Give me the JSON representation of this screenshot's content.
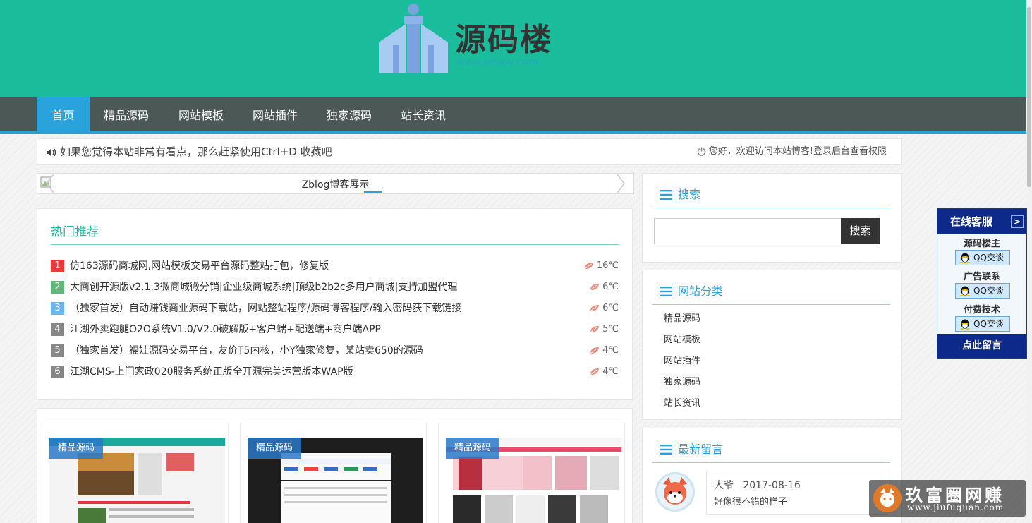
{
  "site": {
    "logo_text": "源码楼",
    "logo_url_text": "www.ymlou.com"
  },
  "nav": {
    "items": [
      {
        "label": "首页",
        "active": true
      },
      {
        "label": "精品源码",
        "active": false
      },
      {
        "label": "网站模板",
        "active": false
      },
      {
        "label": "网站插件",
        "active": false
      },
      {
        "label": "独家源码",
        "active": false
      },
      {
        "label": "站长资讯",
        "active": false
      }
    ]
  },
  "notice": {
    "left": "如果您觉得本站非常有看点，那么赶紧使用Ctrl+D 收藏吧",
    "right": "您好，欢迎访问本站博客!登录后台查看权限"
  },
  "slider": {
    "caption": "Zblog博客展示"
  },
  "hot": {
    "title": "热门推荐",
    "items": [
      {
        "num": "1",
        "text": "仿163源码商城网,网站模板交易平台源码整站打包，修复版",
        "temp": "16℃",
        "color": "#e83c3c"
      },
      {
        "num": "2",
        "text": "大商创开源版v2.1.3微商城微分销|企业级商城系统|顶级b2b2c多用户商城|支持加盟代理",
        "temp": "6℃",
        "color": "#5fb878"
      },
      {
        "num": "3",
        "text": "（独家首发）自动赚钱商业源码下载站，网站整站程序/源码博客程序/输入密码获下载链接",
        "temp": "6℃",
        "color": "#6bb6ea"
      },
      {
        "num": "4",
        "text": "江湖外卖跑腿O2O系统V1.0/V2.0破解版+客户端+配送端+商户端APP",
        "temp": "5℃",
        "color": "#888888"
      },
      {
        "num": "5",
        "text": "（独家首发）福娃源码交易平台，友价T5内核，小Y独家修复，某站卖650的源码",
        "temp": "4℃",
        "color": "#888888"
      },
      {
        "num": "6",
        "text": "江湖CMS-上门家政020服务系统正版全开源完美运营版本WAP版",
        "temp": "4℃",
        "color": "#888888"
      }
    ]
  },
  "cards": [
    {
      "tag": "精品源码"
    },
    {
      "tag": "精品源码"
    },
    {
      "tag": "精品源码"
    }
  ],
  "search": {
    "title": "搜索",
    "button": "搜索",
    "value": ""
  },
  "categories": {
    "title": "网站分类",
    "items": [
      "精品源码",
      "网站模板",
      "网站插件",
      "独家源码",
      "站长资讯"
    ]
  },
  "messages": {
    "title": "最新留言",
    "items": [
      {
        "author": "大爷",
        "date": "2017-08-16",
        "text": "好像很不错的样子"
      }
    ]
  },
  "customer_service": {
    "title": "在线客服",
    "arrow": ">",
    "groups": [
      {
        "label": "源码楼主",
        "button": "QQ交谈"
      },
      {
        "label": "广告联系",
        "button": "QQ交谈"
      },
      {
        "label": "付费技术",
        "button": "QQ交谈"
      }
    ],
    "footer": "点此留言"
  },
  "watermark": {
    "text": "玖富圈网赚",
    "url": "www.jiufuquan.com"
  },
  "colors": {
    "header_bg": "#1abc9c",
    "nav_bg": "#4b5856",
    "accent": "#2aa3dd"
  }
}
